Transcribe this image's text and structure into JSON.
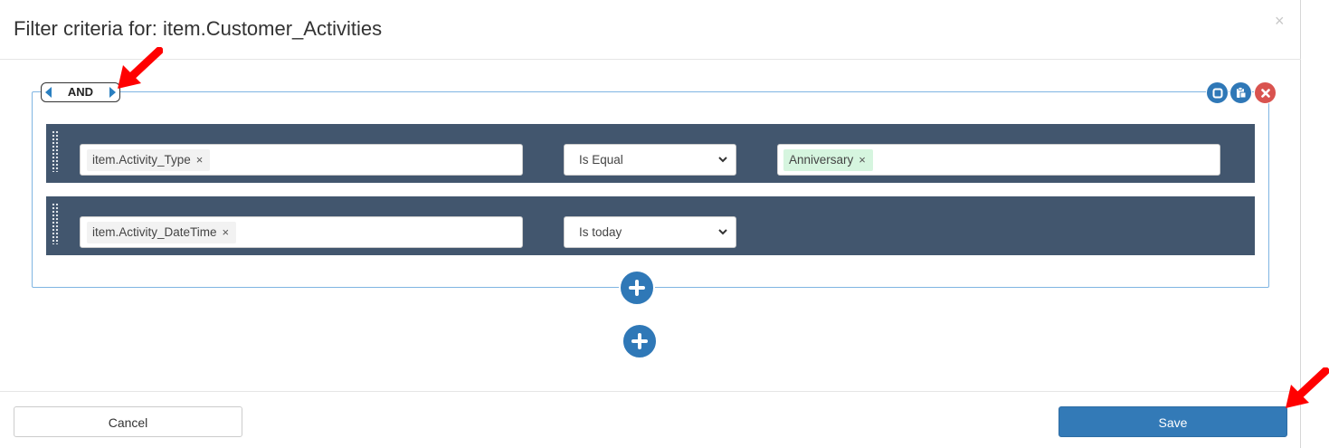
{
  "dialog": {
    "title": "Filter criteria for: item.Customer_Activities",
    "close_glyph": "×"
  },
  "group": {
    "conjunction": "AND",
    "actions": [
      "select-group-icon",
      "paste-icon",
      "delete-group-icon"
    ],
    "rules": [
      {
        "field": "item.Activity_Type",
        "operator": "Is Equal",
        "value": "Anniversary"
      },
      {
        "field": "item.Activity_DateTime",
        "operator": "Is today"
      }
    ]
  },
  "footer": {
    "cancel_label": "Cancel",
    "save_label": "Save"
  },
  "colors": {
    "accent": "#337ab7",
    "rule_row_bg": "#42566e",
    "delete": "#d9534f",
    "value_tag": "#d6f5df",
    "annotation_arrow": "#ff0000"
  },
  "tag_remove_glyph": "×"
}
